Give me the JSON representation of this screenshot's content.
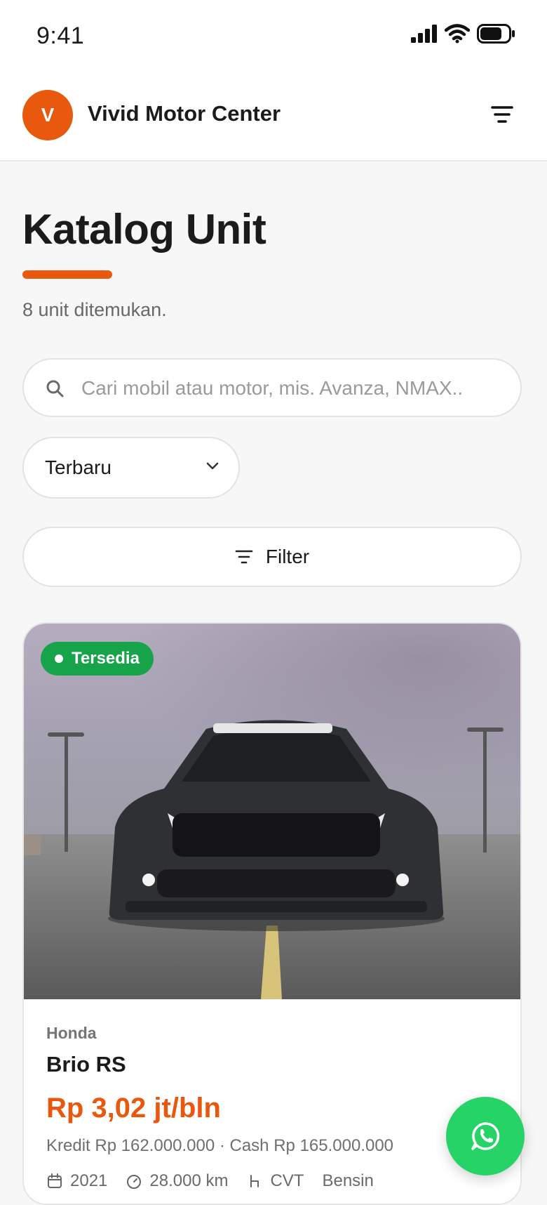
{
  "status_bar": {
    "time": "9:41"
  },
  "header": {
    "logo_letter": "V",
    "brand": "Vivid Motor Center"
  },
  "page": {
    "title": "Katalog Unit",
    "result_count": "8 unit ditemukan."
  },
  "search": {
    "placeholder": "Cari mobil atau motor, mis. Avanza, NMAX.."
  },
  "sort": {
    "selected": "Terbaru"
  },
  "filter": {
    "label": "Filter"
  },
  "listing": {
    "status": "Tersedia",
    "brand": "Honda",
    "model": "Brio RS",
    "price": "Rp 3,02 jt/bln",
    "subprice": "Kredit Rp 162.000.000 · Cash Rp 165.000.000",
    "year": "2021",
    "mileage": "28.000 km",
    "transmission": "CVT",
    "fuel": "Bensin"
  },
  "colors": {
    "accent": "#e8580d",
    "available": "#16a34a",
    "whatsapp": "#25d366"
  }
}
